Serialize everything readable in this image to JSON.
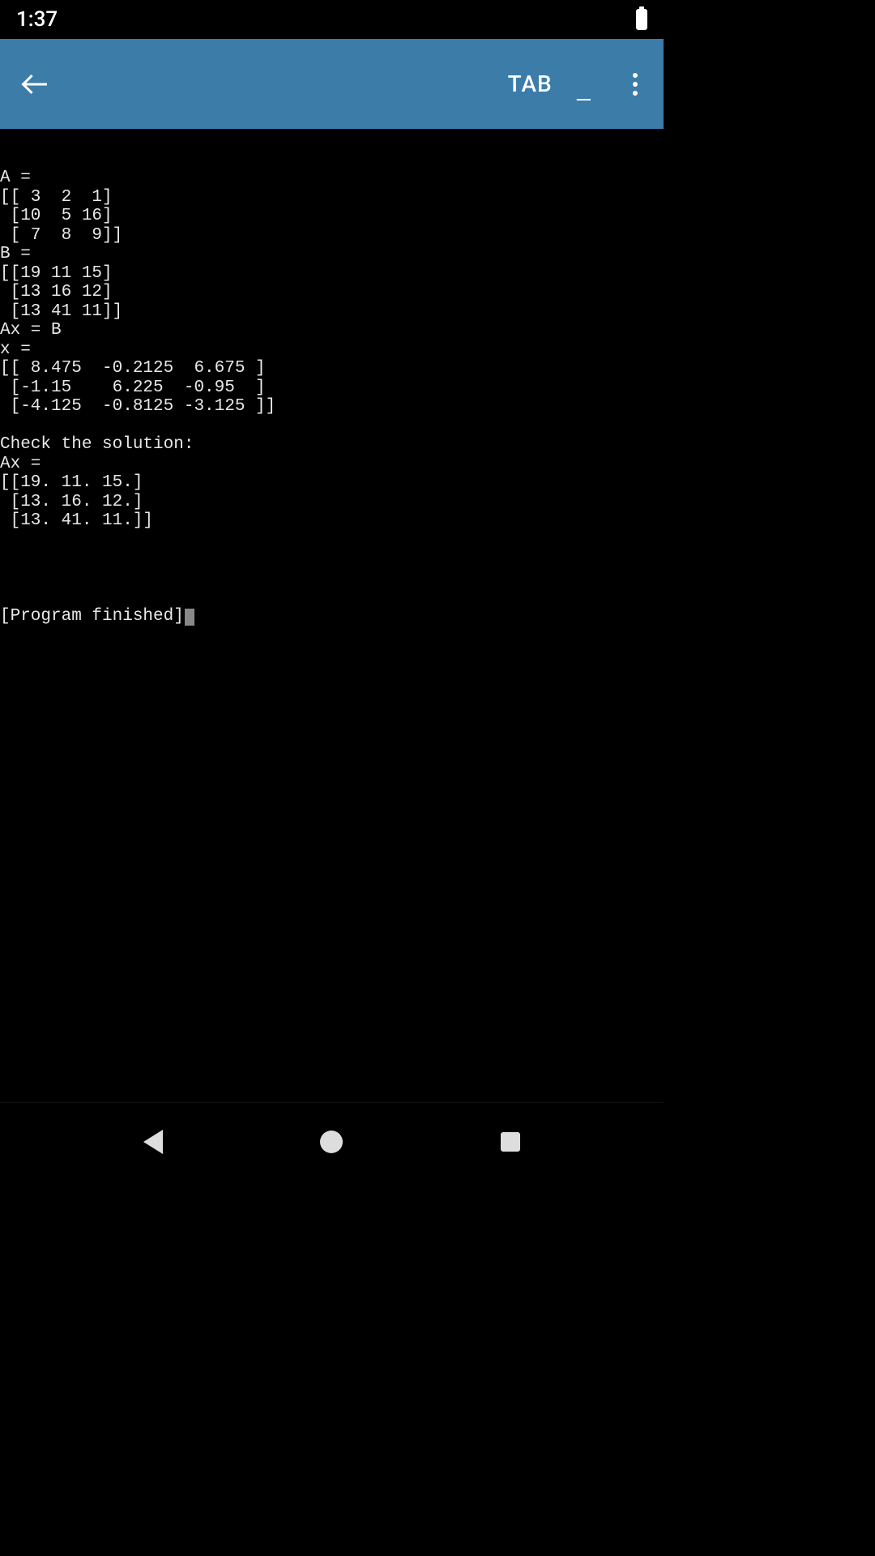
{
  "status": {
    "time": "1:37"
  },
  "toolbar": {
    "tab_label": "TAB",
    "underscore_label": "_"
  },
  "terminal": {
    "lines": [
      "A =",
      "[[ 3  2  1]",
      " [10  5 16]",
      " [ 7  8  9]]",
      "B =",
      "[[19 11 15]",
      " [13 16 12]",
      " [13 41 11]]",
      "Ax = B",
      "x =",
      "[[ 8.475  -0.2125  6.675 ]",
      " [-1.15    6.225  -0.95  ]",
      " [-4.125  -0.8125 -3.125 ]]",
      "",
      "Check the solution:",
      "Ax =",
      "[[19. 11. 15.]",
      " [13. 16. 12.]",
      " [13. 41. 11.]]",
      "",
      ""
    ],
    "finished_text": "[Program finished]"
  }
}
